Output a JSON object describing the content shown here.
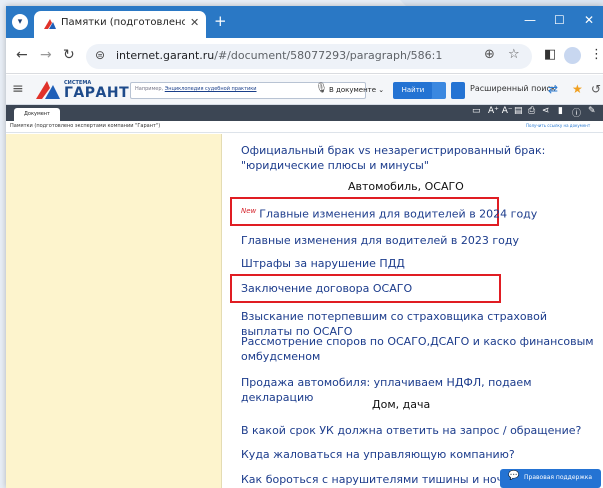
{
  "browser": {
    "tab_title": "Памятки (подготовлено экспе",
    "tab_close": "✕",
    "new_tab": "+",
    "controls": {
      "minimize": "—",
      "maximize": "☐",
      "close": "✕"
    },
    "menu_icon": "chevron-down-icon",
    "url_host": "internet.garant.ru",
    "url_path": "/#/document/58077293/paragraph/586:1"
  },
  "garant_toolbar": {
    "logo_small": "СИСТЕМА",
    "logo_text": "ГАРАНТ",
    "search_prefix": "Например, ",
    "search_link": "Энциклопедия судебной практики",
    "scope_label": "В документе ⌄",
    "find_button": "Найти",
    "advanced_search": "Расширенный поиск"
  },
  "document": {
    "tab_label": "Документ",
    "title": "Памятки (подготовлено экспертами компании \"Гарант\")",
    "link_button": "Получить ссылку на документ",
    "font_size_label": "A⁺ A⁻"
  },
  "content": {
    "items": [
      {
        "text": "Официальный брак vs незарегистрированный брак: \"юридические плюсы и минусы\""
      },
      {
        "text": "Главные изменения для водителей в 2024 году",
        "badge": "New",
        "highlighted": true
      },
      {
        "text": "Главные изменения для водителей в 2023 году"
      },
      {
        "text": "Штрафы за нарушение ПДД"
      },
      {
        "text": "Заключение договора ОСАГО",
        "highlighted": true
      },
      {
        "text": "Взыскание потерпевшим со страховщика страховой выплаты по ОСАГО"
      },
      {
        "text": "Рассмотрение споров по ОСАГО,ДСАГО и каско финансовым омбудсменом"
      },
      {
        "text": "Продажа автомобиля: уплачиваем НДФЛ, подаем декларацию"
      },
      {
        "text": "В какой срок УК должна ответить на запрос / обращение?"
      },
      {
        "text": "Куда жаловаться на управляющую компанию?"
      },
      {
        "text": "Как бороться с нарушителями тишины и ночного по"
      }
    ],
    "headings": [
      {
        "text": "Автомобиль, ОСАГО"
      },
      {
        "text": "Дом, дача"
      }
    ]
  },
  "support_button": "Правовая поддержка",
  "colors": {
    "chrome_blue": "#2a78c5",
    "link_blue": "#1c3c8c",
    "highlight_red": "#e01d23",
    "left_panel": "#fdf4cd",
    "garant_blue": "#2473d3"
  }
}
